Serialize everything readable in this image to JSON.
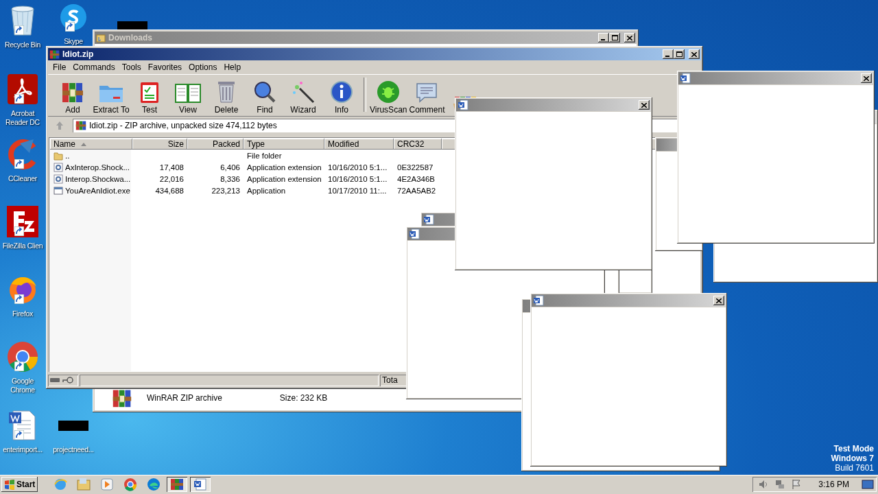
{
  "desktop_icons": [
    {
      "kind": "recycle-bin",
      "label": "Recycle Bin"
    },
    {
      "kind": "skype",
      "label": "Skype"
    },
    {
      "kind": "redacted"
    },
    {
      "kind": "acrobat",
      "label": "Acrobat Reader DC"
    },
    {
      "kind": "ccleaner",
      "label": "CCleaner"
    },
    {
      "kind": "filezilla",
      "label": "FileZilla Clien"
    },
    {
      "kind": "firefox",
      "label": "Firefox"
    },
    {
      "kind": "chrome",
      "label": "Google Chrome"
    },
    {
      "kind": "word-doc",
      "label": "enterimport..."
    },
    {
      "kind": "redacted",
      "label": "projectneed..."
    }
  ],
  "downloads_window": {
    "title": "Downloads",
    "file_type": "WinRAR ZIP archive",
    "file_size": "Size: 232 KB"
  },
  "winrar_window": {
    "title": "Idiot.zip",
    "menu": [
      "File",
      "Commands",
      "Tools",
      "Favorites",
      "Options",
      "Help"
    ],
    "toolbar": [
      {
        "kind": "add",
        "label": "Add"
      },
      {
        "kind": "extract",
        "label": "Extract To"
      },
      {
        "kind": "test",
        "label": "Test"
      },
      {
        "kind": "view",
        "label": "View"
      },
      {
        "kind": "delete",
        "label": "Delete"
      },
      {
        "kind": "find",
        "label": "Find"
      },
      {
        "kind": "wizard",
        "label": "Wizard"
      },
      {
        "kind": "info",
        "label": "Info"
      },
      {
        "kind": "separator"
      },
      {
        "kind": "virusscan",
        "label": "VirusScan"
      },
      {
        "kind": "comment",
        "label": "Comment"
      },
      {
        "kind": "sfx"
      }
    ],
    "address": "Idiot.zip - ZIP archive, unpacked size 474,112 bytes",
    "columns": [
      {
        "label": "Name",
        "sorted": true
      },
      {
        "label": "Size",
        "sorted": false
      },
      {
        "label": "Packed",
        "sorted": false
      },
      {
        "label": "Type",
        "sorted": false
      },
      {
        "label": "Modified",
        "sorted": false
      },
      {
        "label": "CRC32",
        "sorted": false
      }
    ],
    "files": [
      {
        "kind": "folder",
        "name": "..",
        "type": "File folder"
      },
      {
        "kind": "dll",
        "name": "AxInterop.Shock...",
        "size": "17,408",
        "packed": "6,406",
        "type": "Application extension",
        "modified": "10/16/2010 5:1...",
        "crc32": "0E322587"
      },
      {
        "kind": "dll",
        "name": "Interop.Shockwa...",
        "size": "22,016",
        "packed": "8,336",
        "type": "Application extension",
        "modified": "10/16/2010 5:1...",
        "crc32": "4E2A346B"
      },
      {
        "kind": "exe",
        "name": "YouAreAnIdiot.exe",
        "size": "434,688",
        "packed": "223,213",
        "type": "Application",
        "modified": "10/17/2010 11:...",
        "crc32": "72AA5AB2"
      }
    ],
    "status_text": "Tota"
  },
  "popup_windows": [
    {
      "kind": "blank-window"
    },
    {
      "kind": "blank-window"
    },
    {
      "kind": "blank-window"
    },
    {
      "kind": "blank-window"
    },
    {
      "kind": "blank-window"
    },
    {
      "kind": "blank-window"
    },
    {
      "kind": "blank-window"
    },
    {
      "kind": "blank-window"
    },
    {
      "kind": "blank-window"
    }
  ],
  "os_notice": [
    {
      "text": "Test Mode",
      "bold": true
    },
    {
      "text": "Windows 7",
      "bold": true
    },
    {
      "text": "Build 7601",
      "bold": false
    }
  ],
  "taskbar": {
    "start_label": "Start",
    "items": [
      {
        "kind": "ie",
        "selected": false
      },
      {
        "kind": "explorer",
        "selected": false
      },
      {
        "kind": "media",
        "selected": false
      },
      {
        "kind": "chrome",
        "selected": false
      },
      {
        "kind": "edge",
        "selected": false
      },
      {
        "kind": "winrar",
        "selected": true
      },
      {
        "kind": "word",
        "selected": true
      }
    ],
    "clock": "3:16 PM"
  }
}
